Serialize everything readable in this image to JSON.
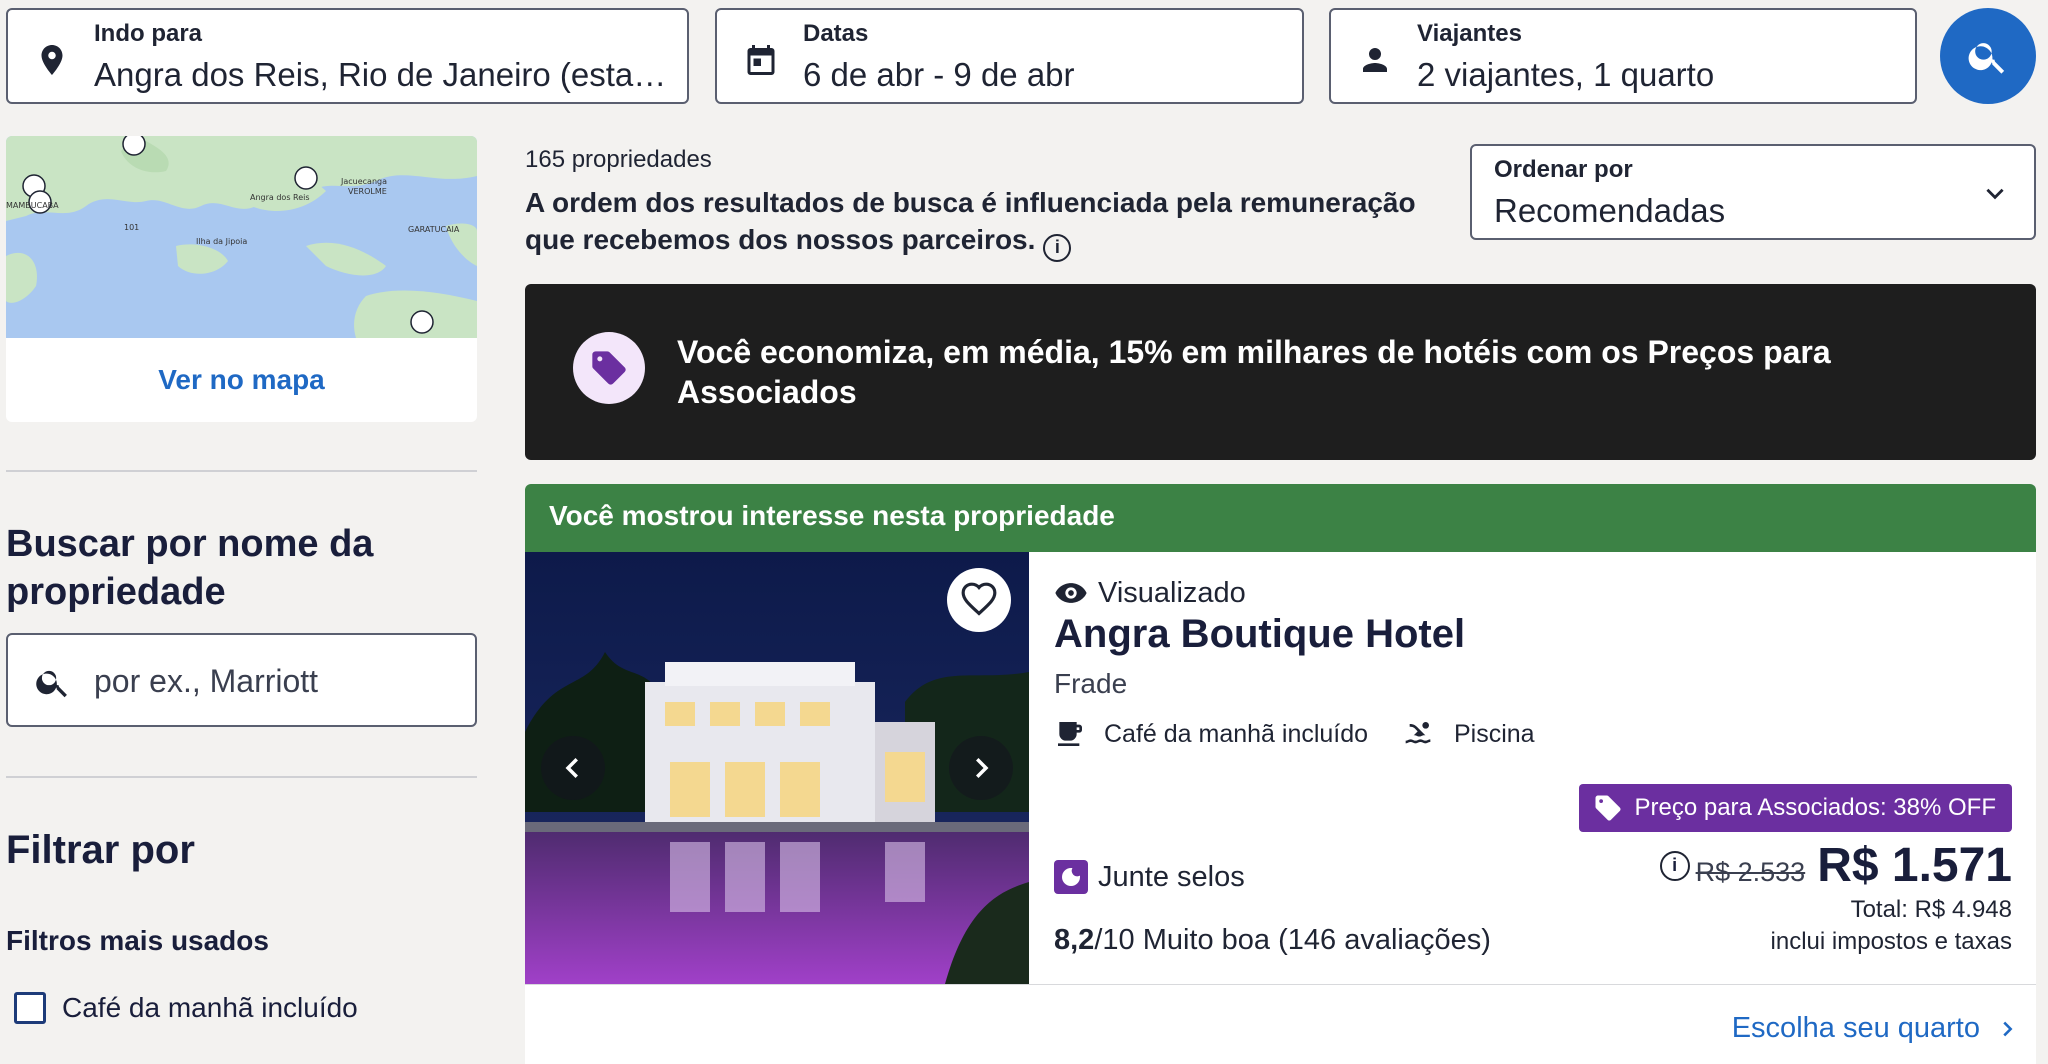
{
  "search": {
    "destination_label": "Indo para",
    "destination_value": "Angra dos Reis, Rio de Janeiro (estad...",
    "dates_label": "Datas",
    "dates_value": "6 de abr - 9 de abr",
    "travelers_label": "Viajantes",
    "travelers_value": "2 viajantes, 1 quarto"
  },
  "map": {
    "link_label": "Ver no mapa",
    "place_labels": [
      "Angra dos Reis",
      "Jacuecanga",
      "VEROLME",
      "Ilha da Jipoia",
      "GARATUCAIA",
      "MAMBUCABA",
      "101"
    ]
  },
  "property_search": {
    "title": "Buscar por nome da propriedade",
    "placeholder": "por ex., Marriott"
  },
  "filters": {
    "title": "Filtrar por",
    "subtitle": "Filtros mais usados",
    "options": [
      {
        "label": "Café da manhã incluído",
        "checked": false
      }
    ]
  },
  "results": {
    "count": "165 propriedades",
    "disclaimer": "A ordem dos resultados de busca é influenciada pela remuneração que recebemos dos nossos parceiros.",
    "info_glyph": "i",
    "sort_label": "Ordenar por",
    "sort_value": "Recomendadas"
  },
  "promo": {
    "text": "Você economiza, em média, 15% em milhares de hotéis com os Preços para Associados"
  },
  "listing": {
    "banner": "Você mostrou interesse nesta propriedade",
    "viewed": "Visualizado",
    "name": "Angra Boutique Hotel",
    "location": "Frade",
    "amenity_breakfast": "Café da manhã incluído",
    "amenity_pool": "Piscina",
    "member_tag": "Preço para Associados: 38% OFF",
    "old_price": "R$ 2.533",
    "price": "R$ 1.571",
    "total": "Total: R$ 4.948",
    "taxes": "inclui impostos e taxas",
    "stamps": "Junte selos",
    "rating_score": "8,2",
    "rating_text": "/10 Muito boa (146 avaliações)",
    "choose_room": "Escolha seu quarto"
  },
  "colors": {
    "primary_blue": "#1f69c4",
    "promo_bg": "#1e1e1e",
    "banner_green": "#3c8245",
    "member_purple": "#6b2fa0",
    "page_bg": "#f3f2f0"
  },
  "icons": [
    "location-pin-icon",
    "calendar-icon",
    "person-icon",
    "search-icon",
    "chevron-down-icon",
    "price-tag-icon",
    "heart-icon",
    "eye-icon",
    "coffee-icon",
    "pool-icon",
    "moon-icon",
    "info-icon",
    "chevron-left-icon",
    "chevron-right-icon"
  ]
}
